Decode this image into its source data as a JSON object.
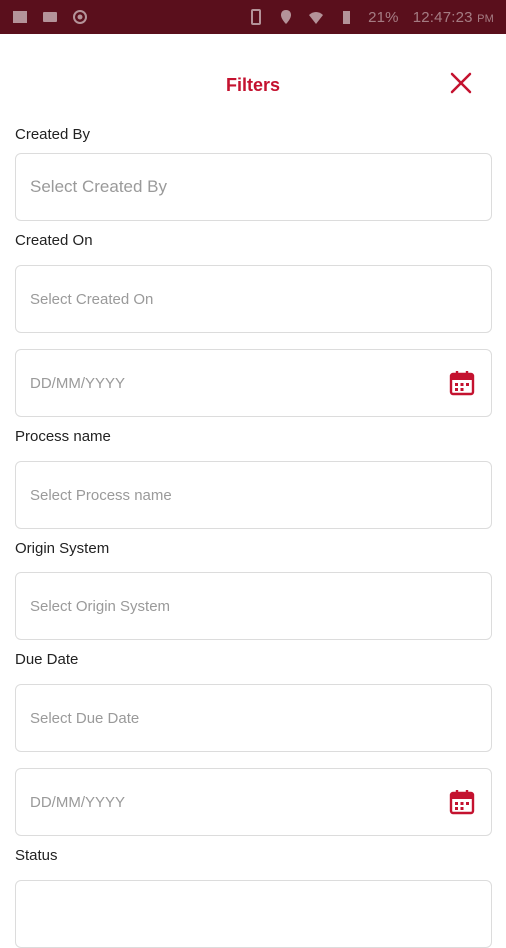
{
  "status_bar": {
    "battery": "21%",
    "time": "12:47:23",
    "ampm": "PM"
  },
  "header": {
    "title": "Filters",
    "accent_color": "#c4122f"
  },
  "fields": {
    "created_by_label": "Created By",
    "created_by_placeholder": "Select Created By",
    "created_on_label": "Created On",
    "created_on_placeholder": "Select Created On",
    "created_on_date_placeholder": "DD/MM/YYYY",
    "process_name_label": "Process name",
    "process_name_placeholder": "Select Process name",
    "origin_system_label": "Origin System",
    "origin_system_placeholder": "Select Origin System",
    "due_date_label": "Due Date",
    "due_date_placeholder": "Select Due Date",
    "due_date_date_placeholder": "DD/MM/YYYY",
    "status_label": "Status"
  },
  "icons": {
    "close": "close-icon",
    "calendar": "calendar-icon"
  }
}
